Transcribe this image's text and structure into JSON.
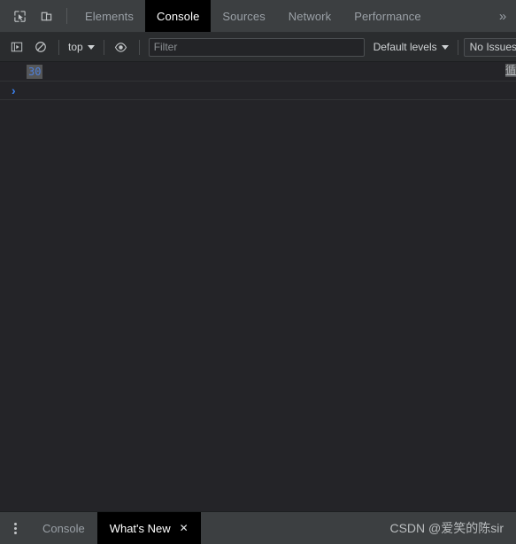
{
  "window": {
    "app": "Chrome DevTools",
    "background_color": "#242428",
    "panel_color": "#3c3f41",
    "toolbar_color": "#2a2c2e",
    "accent_color": "#3b80ec"
  },
  "tabbar": {
    "inspect_icon": "inspect-element-icon",
    "device_icon": "device-toolbar-icon",
    "overflow_label": "»",
    "tabs": [
      {
        "label": "Elements",
        "active": false
      },
      {
        "label": "Console",
        "active": true
      },
      {
        "label": "Sources",
        "active": false
      },
      {
        "label": "Network",
        "active": false
      },
      {
        "label": "Performance",
        "active": false
      }
    ]
  },
  "toolbar": {
    "sidebar_icon": "console-sidebar-icon",
    "clear_icon": "clear-console-icon",
    "eye_icon": "live-expression-icon",
    "context_label": "top",
    "filter_placeholder": "Filter",
    "filter_value": "",
    "levels_label": "Default levels",
    "issues_label": "No Issues"
  },
  "console": {
    "messages": [
      {
        "value": "30",
        "value_color": "#4f7fd8",
        "selected": true,
        "source": "循"
      }
    ],
    "prompt_symbol": "›"
  },
  "drawer": {
    "menu_icon": "more-options-icon",
    "tabs": [
      {
        "label": "Console",
        "active": false,
        "closable": false
      },
      {
        "label": "What's New",
        "active": true,
        "closable": true
      }
    ],
    "close_symbol": "✕",
    "watermark": "CSDN @爱笑的陈sir"
  }
}
